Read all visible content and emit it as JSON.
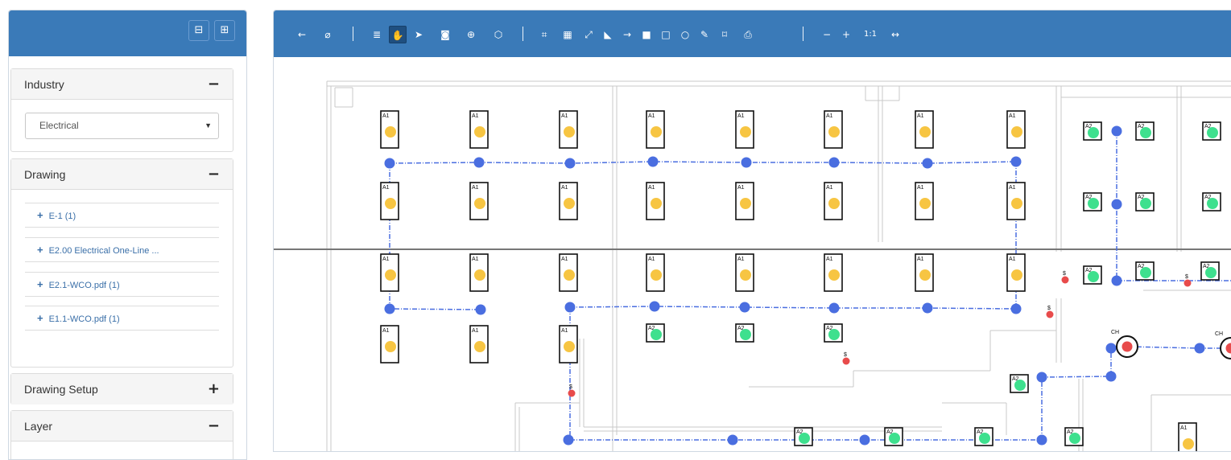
{
  "sidebar": {
    "header_buttons": [
      {
        "icon": "collapse-all-icon",
        "glyph": "⊟"
      },
      {
        "icon": "expand-all-icon",
        "glyph": "⊞"
      }
    ],
    "panels": {
      "industry": {
        "title": "Industry",
        "toggle": "−",
        "selected": "Electrical"
      },
      "drawing": {
        "title": "Drawing",
        "toggle": "−",
        "items": [
          {
            "label": "E-1 (1)"
          },
          {
            "label": "E2.00 Electrical One-Line ..."
          },
          {
            "label": "E2.1-WCO.pdf (1)"
          },
          {
            "label": "E1.1-WCO.pdf (1)"
          }
        ]
      },
      "drawing_setup": {
        "title": "Drawing Setup",
        "toggle": "+"
      },
      "layer": {
        "title": "Layer",
        "toggle": "−"
      }
    }
  },
  "toolbar": {
    "tools": [
      {
        "name": "back-icon",
        "glyph": "←"
      },
      {
        "name": "hide-icon",
        "glyph": "⌀"
      },
      {
        "name": "align-icon",
        "glyph": "≣"
      },
      {
        "name": "pan-hand-icon",
        "glyph": "✋"
      },
      {
        "name": "pointer-icon",
        "glyph": "➤"
      },
      {
        "name": "camera-icon",
        "glyph": "◙"
      },
      {
        "name": "crosshair-icon",
        "glyph": "⊕"
      },
      {
        "name": "cube-icon",
        "glyph": "⬡"
      },
      {
        "name": "crop-icon",
        "glyph": "⌗"
      },
      {
        "name": "calculator-icon",
        "glyph": "▦"
      },
      {
        "name": "line-measure-icon",
        "glyph": "⤢"
      },
      {
        "name": "area-chart-icon",
        "glyph": "◣"
      },
      {
        "name": "arrow-right-icon",
        "glyph": "→"
      },
      {
        "name": "fill-square-icon",
        "glyph": "■"
      },
      {
        "name": "rectangle-icon",
        "glyph": "□"
      },
      {
        "name": "circle-icon",
        "glyph": "○"
      },
      {
        "name": "highlighter-icon",
        "glyph": "✎"
      },
      {
        "name": "frame-icon",
        "glyph": "⌑"
      },
      {
        "name": "print-icon",
        "glyph": "⎙"
      },
      {
        "name": "zoom-out-icon",
        "glyph": "−"
      },
      {
        "name": "zoom-in-icon",
        "glyph": "+"
      },
      {
        "name": "actual-size",
        "glyph": "1:1"
      },
      {
        "name": "fit-width-icon",
        "glyph": "↔"
      }
    ]
  },
  "drawing": {
    "labels": {
      "fixture_a1": "A1",
      "fixture_a2": "A2",
      "ch": "CH",
      "switch": "$"
    },
    "colors": {
      "fixture_a1": "#f7c542",
      "fixture_a2": "#3ee08e",
      "path": "#4a6ee0",
      "switch": "#e84b4b",
      "toolbar": "#3a7ab8"
    }
  }
}
